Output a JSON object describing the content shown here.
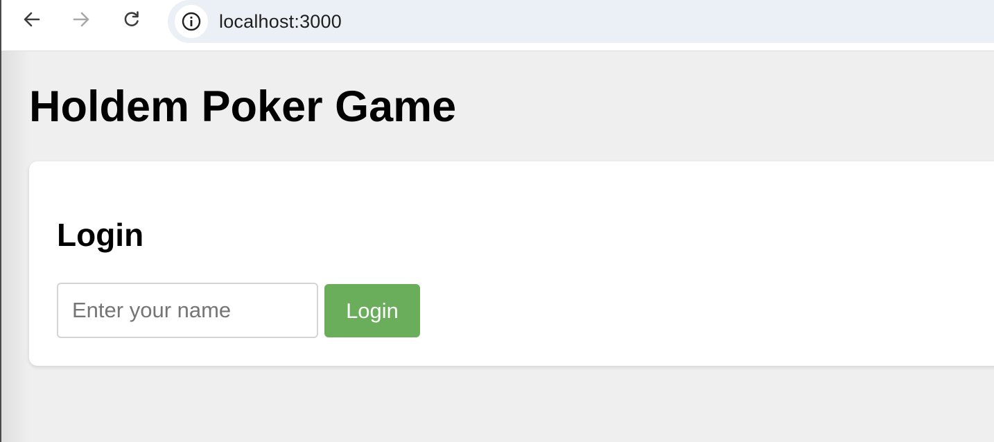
{
  "browser": {
    "url": "localhost:3000",
    "icons": {
      "back": "arrow-left-icon",
      "forward": "arrow-right-icon",
      "reload": "reload-icon",
      "site_info": "info-icon"
    },
    "forward_enabled": false
  },
  "page": {
    "title": "Holdem Poker Game"
  },
  "login": {
    "heading": "Login",
    "name_placeholder": "Enter your name",
    "name_value": "",
    "button_label": "Login",
    "button_color": "#6aae5c"
  }
}
